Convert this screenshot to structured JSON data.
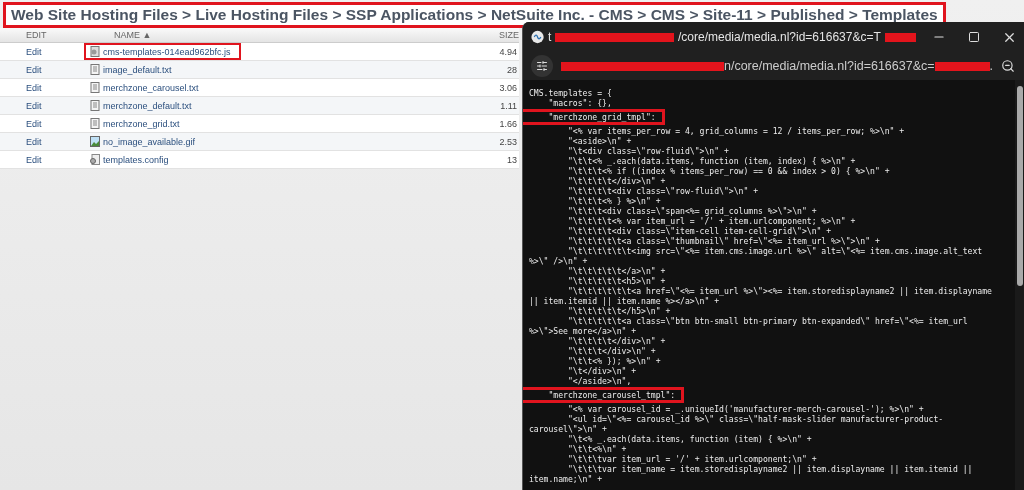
{
  "breadcrumb": {
    "text": "Web Site Hosting Files > Live Hosting Files > SSP Applications > NetSuite Inc. - CMS > CMS > Site-11 > Published > Templates",
    "highlighted": true
  },
  "table": {
    "columns": [
      "EDIT",
      "NAME ▲",
      "SIZE"
    ],
    "rows": [
      {
        "edit": "Edit",
        "name": "cms-templates-014ead962bfc.js",
        "size": "4.94",
        "kind": "script",
        "highlighted": true
      },
      {
        "edit": "Edit",
        "name": "image_default.txt",
        "size": "28",
        "kind": "text",
        "highlighted": false
      },
      {
        "edit": "Edit",
        "name": "merchzone_carousel.txt",
        "size": "3.06",
        "kind": "text",
        "highlighted": false
      },
      {
        "edit": "Edit",
        "name": "merchzone_default.txt",
        "size": "1.11",
        "kind": "text",
        "highlighted": false
      },
      {
        "edit": "Edit",
        "name": "merchzone_grid.txt",
        "size": "1.66",
        "kind": "text",
        "highlighted": false
      },
      {
        "edit": "Edit",
        "name": "no_image_available.gif",
        "size": "2.53",
        "kind": "image",
        "highlighted": false
      },
      {
        "edit": "Edit",
        "name": "templates.config",
        "size": "13",
        "kind": "config",
        "highlighted": false
      }
    ]
  },
  "window": {
    "title": [
      "t",
      "/core/media/media.nl?id=616637&c=T"
    ],
    "address": [
      "n/core/media/media.nl?id=616637&c=",
      "."
    ],
    "code_lines": [
      {
        "text": "CMS.templates = {",
        "highlighted": false
      },
      {
        "text": "    \"macros\": {},",
        "highlighted": false
      },
      {
        "text": "    \"merchzone_grid_tmpl\":",
        "highlighted": true
      },
      {
        "text": "        \"<% var items_per_row = 4, grid_columns = 12 / items_per_row; %>\\n\" +",
        "highlighted": false
      },
      {
        "text": "        \"<aside>\\n\" +",
        "highlighted": false
      },
      {
        "text": "        \"\\t<div class=\\\"row-fluid\\\">\\n\" +",
        "highlighted": false
      },
      {
        "text": "        \"\\t\\t<% _.each(data.items, function (item, index) { %>\\n\" +",
        "highlighted": false
      },
      {
        "text": "        \"\\t\\t\\t<% if ((index % items_per_row) == 0 && index > 0) { %>\\n\" +",
        "highlighted": false
      },
      {
        "text": "        \"\\t\\t\\t\\t</div>\\n\" +",
        "highlighted": false
      },
      {
        "text": "        \"\\t\\t\\t\\t<div class=\\\"row-fluid\\\">\\n\" +",
        "highlighted": false
      },
      {
        "text": "        \"\\t\\t\\t<% } %>\\n\" +",
        "highlighted": false
      },
      {
        "text": "        \"\\t\\t\\t<div class=\\\"span<%= grid_columns %>\\\">\\n\" +",
        "highlighted": false
      },
      {
        "text": "        \"\\t\\t\\t\\t<% var item_url = '/' + item.urlcomponent; %>\\n\" +",
        "highlighted": false
      },
      {
        "text": "        \"\\t\\t\\t\\t<div class=\\\"item-cell item-cell-grid\\\">\\n\" +",
        "highlighted": false
      },
      {
        "text": "        \"\\t\\t\\t\\t\\t<a class=\\\"thumbnail\\\" href=\\\"<%= item_url %>\\\">\\n\" +",
        "highlighted": false
      },
      {
        "text": "        \"\\t\\t\\t\\t\\t\\t<img src=\\\"<%= item.cms.image.url %>\\\" alt=\\\"<%= item.cms.image.alt_text %>\\\" />\\n\" +",
        "highlighted": false
      },
      {
        "text": "        \"\\t\\t\\t\\t\\t</a>\\n\" +",
        "highlighted": false
      },
      {
        "text": "        \"\\t\\t\\t\\t\\t<h5>\\n\" +",
        "highlighted": false
      },
      {
        "text": "        \"\\t\\t\\t\\t\\t\\t<a href=\\\"<%= item_url %>\\\"><%= item.storedisplayname2 || item.displayname || item.itemid || item.name %></a>\\n\" +",
        "highlighted": false
      },
      {
        "text": "        \"\\t\\t\\t\\t\\t</h5>\\n\" +",
        "highlighted": false
      },
      {
        "text": "        \"\\t\\t\\t\\t\\t<a class=\\\"btn btn-small btn-primary btn-expanded\\\" href=\\\"<%= item_url %>\\\">See more</a>\\n\" +",
        "highlighted": false
      },
      {
        "text": "        \"\\t\\t\\t\\t</div>\\n\" +",
        "highlighted": false
      },
      {
        "text": "        \"\\t\\t\\t</div>\\n\" +",
        "highlighted": false
      },
      {
        "text": "        \"\\t\\t<% }); %>\\n\" +",
        "highlighted": false
      },
      {
        "text": "        \"\\t</div>\\n\" +",
        "highlighted": false
      },
      {
        "text": "        \"</aside>\\n\",",
        "highlighted": false
      },
      {
        "text": "    \"merchzone_carousel_tmpl\":",
        "highlighted": true
      },
      {
        "text": "        \"<% var carousel_id = _.uniqueId('manufacturer-merch-carousel-'); %>\\n\" +",
        "highlighted": false
      },
      {
        "text": "        \"<ul id=\\\"<%= carousel_id %>\\\" class=\\\"half-mask-slider manufacturer-product-carousel\\\">\\n\" +",
        "highlighted": false
      },
      {
        "text": "        \"\\t<% _.each(data.items, function (item) { %>\\n\" +",
        "highlighted": false
      },
      {
        "text": "        \"\\t\\t<%\\n\" +",
        "highlighted": false
      },
      {
        "text": "        \"\\t\\t\\tvar item_url = '/' + item.urlcomponent;\\n\" +",
        "highlighted": false
      },
      {
        "text": "        \"\\t\\t\\tvar item_name = item.storedisplayname2 || item.displayname || item.itemid || item.name;\\n\" +",
        "highlighted": false
      }
    ]
  }
}
